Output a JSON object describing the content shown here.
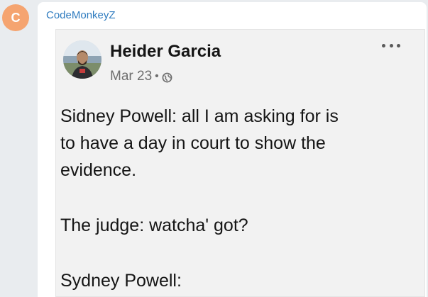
{
  "sender": {
    "avatar_letter": "C",
    "avatar_color": "#f5a470",
    "name": "CodeMonkeyZ",
    "name_color": "#2e7bbf"
  },
  "fb_post": {
    "author": "Heider Garcia",
    "date": "Mar 23",
    "separator": "•",
    "privacy_icon": "globe-icon",
    "more_icon": "more-options-icon",
    "lines": [
      "Sidney Powell: all I am asking for is",
      "to have a day in court to show the",
      "evidence.",
      "The judge: watcha' got?",
      "Sydney Powell:"
    ]
  }
}
